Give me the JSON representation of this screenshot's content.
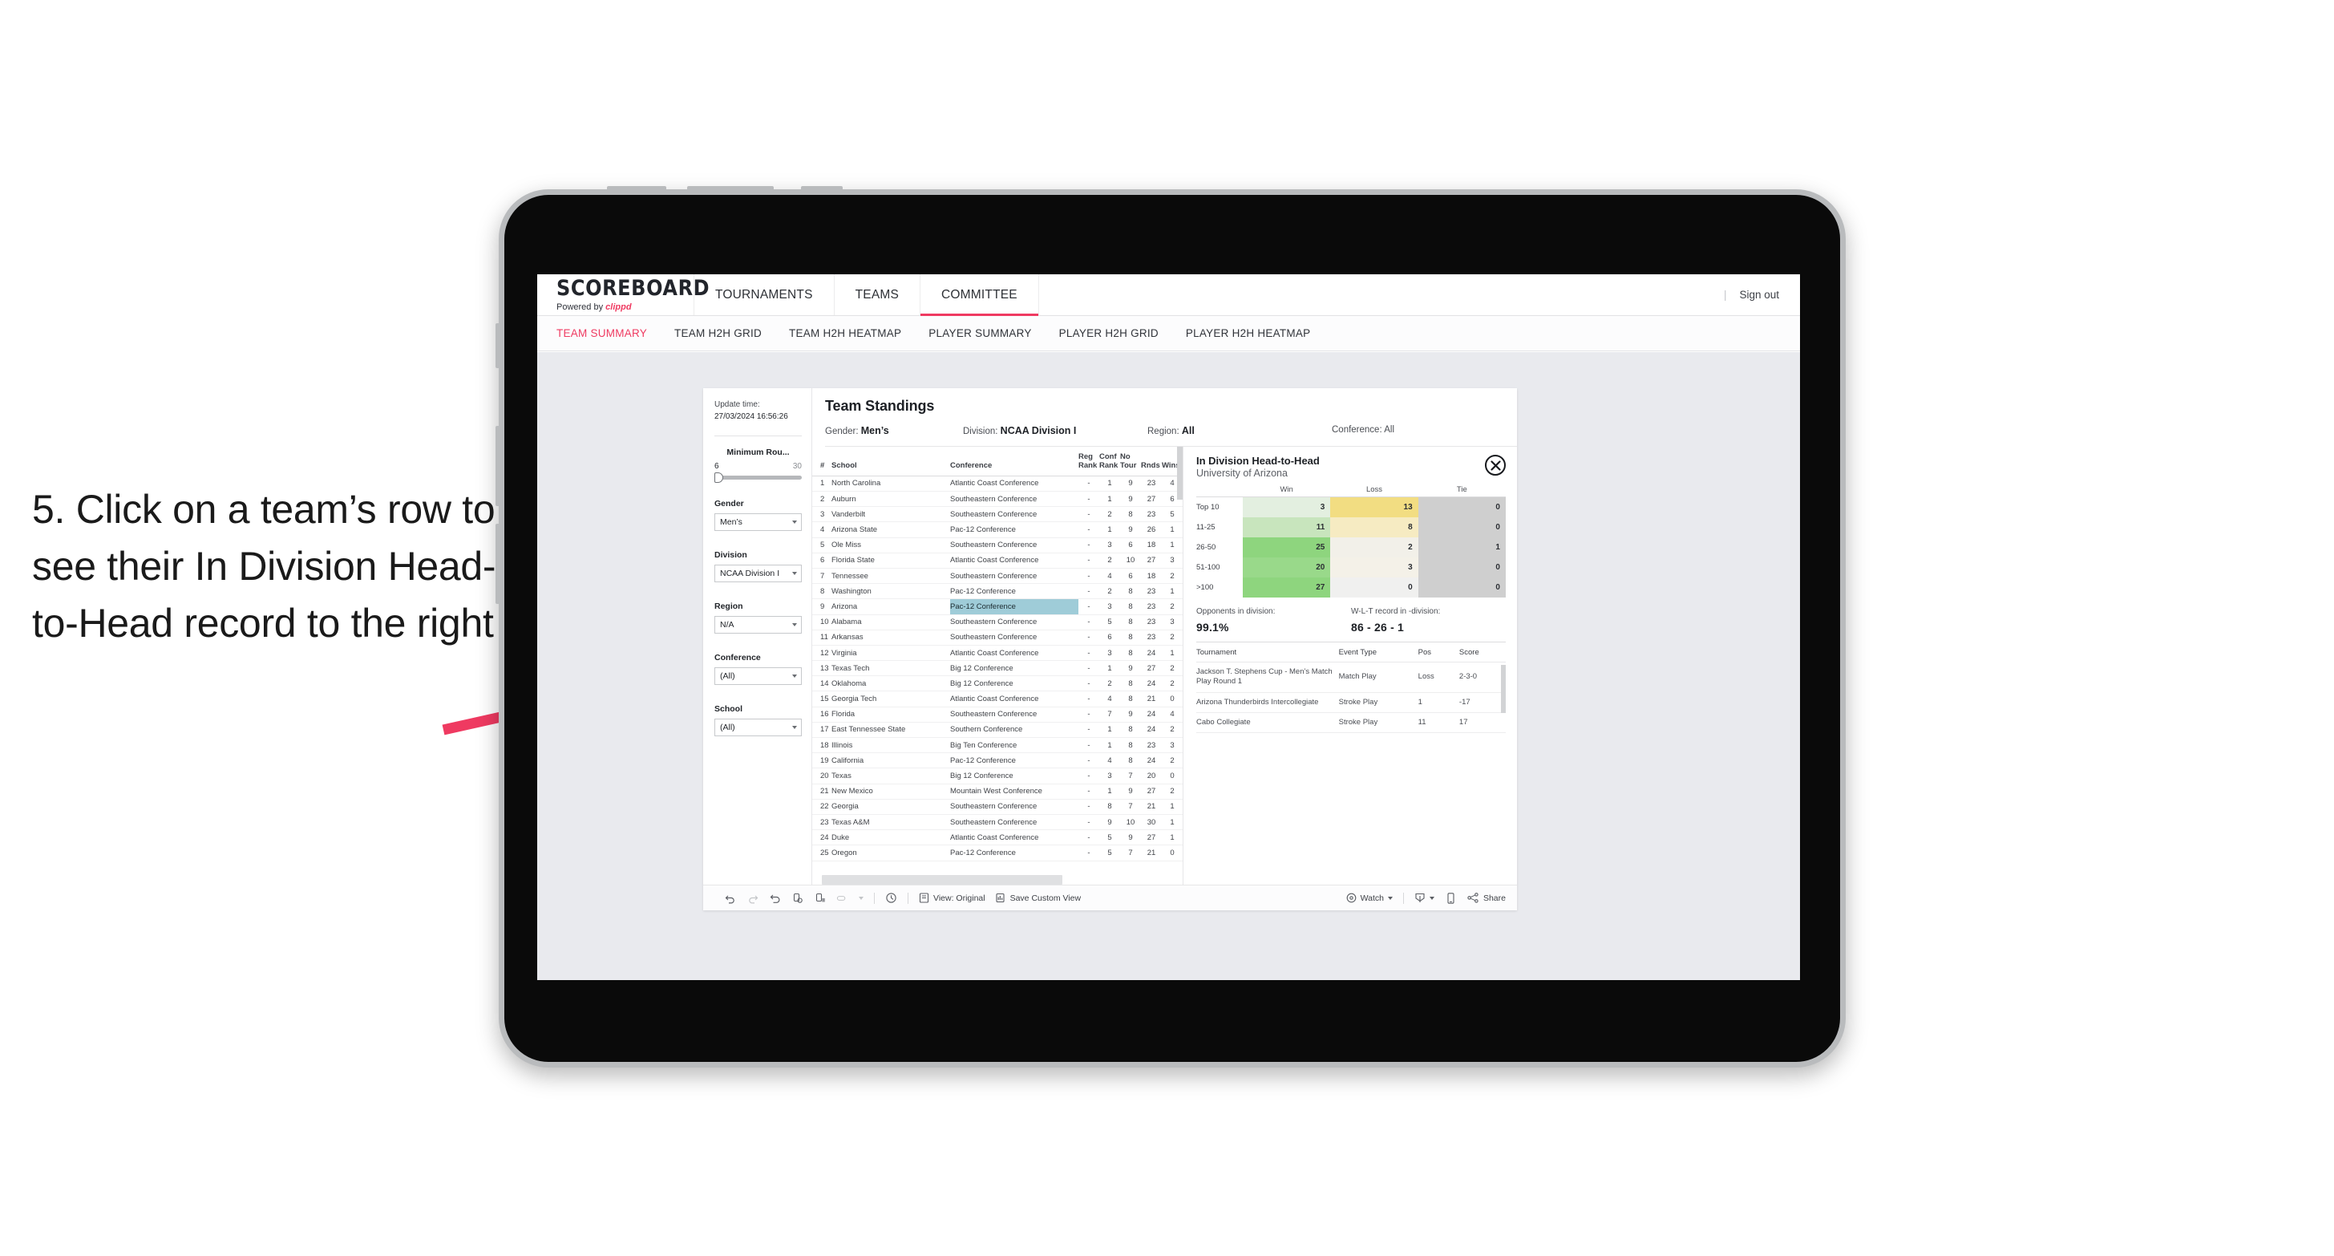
{
  "annotation": {
    "text": "5. Click on a team’s row to see their In Division Head-to-Head record to the right",
    "arrow_color": "#ef3a61"
  },
  "header": {
    "brand_title": "SCOREBOARD",
    "brand_sub_prefix": "Powered by ",
    "brand_sub_name": "clippd",
    "nav": [
      {
        "label": "TOURNAMENTS",
        "active": false
      },
      {
        "label": "TEAMS",
        "active": false
      },
      {
        "label": "COMMITTEE",
        "active": true
      }
    ],
    "divider": "|",
    "sign_out": "Sign out",
    "accent_color": "#ef3a61"
  },
  "subtabs": [
    {
      "label": "TEAM SUMMARY",
      "active": true
    },
    {
      "label": "TEAM H2H GRID",
      "active": false
    },
    {
      "label": "TEAM H2H HEATMAP",
      "active": false
    },
    {
      "label": "PLAYER SUMMARY",
      "active": false
    },
    {
      "label": "PLAYER H2H GRID",
      "active": false
    },
    {
      "label": "PLAYER H2H HEATMAP",
      "active": false
    }
  ],
  "filters": {
    "update_label": "Update time:",
    "update_value": "27/03/2024 16:56:26",
    "minimum_rounds": {
      "title": "Minimum Rou...",
      "min": "6",
      "max": "30"
    },
    "gender": {
      "title": "Gender",
      "value": "Men’s"
    },
    "division": {
      "title": "Division",
      "value": "NCAA Division I"
    },
    "region": {
      "title": "Region",
      "value": "N/A"
    },
    "conference": {
      "title": "Conference",
      "value": "(All)"
    },
    "school": {
      "title": "School",
      "value": "(All)"
    }
  },
  "standings": {
    "title": "Team Standings",
    "summary": [
      {
        "label": "Gender:",
        "value": "Men’s"
      },
      {
        "label": "Division:",
        "value": "NCAA Division I"
      },
      {
        "label": "Region:",
        "value": "All"
      },
      {
        "label": "Conference:",
        "value": "All"
      }
    ],
    "columns": {
      "rank": "#",
      "school": "School",
      "conference": "Conference",
      "reg_rank": "Reg Rank",
      "reg_rank_l1": "Reg",
      "reg_rank_l2": "Rank",
      "conf_rank_l1": "Conf",
      "conf_rank_l2": "Rank",
      "no_tour_l1": "No",
      "no_tour_l2": "Tour",
      "rnds": "Rnds",
      "wins": "Wins"
    },
    "selected_row_index": 8,
    "rows": [
      {
        "rank": "1",
        "school": "North Carolina",
        "conference": "Atlantic Coast Conference",
        "reg": "-",
        "conf": "1",
        "no_tour": "9",
        "rnds": "23",
        "wins": "4"
      },
      {
        "rank": "2",
        "school": "Auburn",
        "conference": "Southeastern Conference",
        "reg": "-",
        "conf": "1",
        "no_tour": "9",
        "rnds": "27",
        "wins": "6"
      },
      {
        "rank": "3",
        "school": "Vanderbilt",
        "conference": "Southeastern Conference",
        "reg": "-",
        "conf": "2",
        "no_tour": "8",
        "rnds": "23",
        "wins": "5"
      },
      {
        "rank": "4",
        "school": "Arizona State",
        "conference": "Pac-12 Conference",
        "reg": "-",
        "conf": "1",
        "no_tour": "9",
        "rnds": "26",
        "wins": "1"
      },
      {
        "rank": "5",
        "school": "Ole Miss",
        "conference": "Southeastern Conference",
        "reg": "-",
        "conf": "3",
        "no_tour": "6",
        "rnds": "18",
        "wins": "1"
      },
      {
        "rank": "6",
        "school": "Florida State",
        "conference": "Atlantic Coast Conference",
        "reg": "-",
        "conf": "2",
        "no_tour": "10",
        "rnds": "27",
        "wins": "3"
      },
      {
        "rank": "7",
        "school": "Tennessee",
        "conference": "Southeastern Conference",
        "reg": "-",
        "conf": "4",
        "no_tour": "6",
        "rnds": "18",
        "wins": "2"
      },
      {
        "rank": "8",
        "school": "Washington",
        "conference": "Pac-12 Conference",
        "reg": "-",
        "conf": "2",
        "no_tour": "8",
        "rnds": "23",
        "wins": "1"
      },
      {
        "rank": "9",
        "school": "Arizona",
        "conference": "Pac-12 Conference",
        "reg": "-",
        "conf": "3",
        "no_tour": "8",
        "rnds": "23",
        "wins": "2"
      },
      {
        "rank": "10",
        "school": "Alabama",
        "conference": "Southeastern Conference",
        "reg": "-",
        "conf": "5",
        "no_tour": "8",
        "rnds": "23",
        "wins": "3"
      },
      {
        "rank": "11",
        "school": "Arkansas",
        "conference": "Southeastern Conference",
        "reg": "-",
        "conf": "6",
        "no_tour": "8",
        "rnds": "23",
        "wins": "2"
      },
      {
        "rank": "12",
        "school": "Virginia",
        "conference": "Atlantic Coast Conference",
        "reg": "-",
        "conf": "3",
        "no_tour": "8",
        "rnds": "24",
        "wins": "1"
      },
      {
        "rank": "13",
        "school": "Texas Tech",
        "conference": "Big 12 Conference",
        "reg": "-",
        "conf": "1",
        "no_tour": "9",
        "rnds": "27",
        "wins": "2"
      },
      {
        "rank": "14",
        "school": "Oklahoma",
        "conference": "Big 12 Conference",
        "reg": "-",
        "conf": "2",
        "no_tour": "8",
        "rnds": "24",
        "wins": "2"
      },
      {
        "rank": "15",
        "school": "Georgia Tech",
        "conference": "Atlantic Coast Conference",
        "reg": "-",
        "conf": "4",
        "no_tour": "8",
        "rnds": "21",
        "wins": "0"
      },
      {
        "rank": "16",
        "school": "Florida",
        "conference": "Southeastern Conference",
        "reg": "-",
        "conf": "7",
        "no_tour": "9",
        "rnds": "24",
        "wins": "4"
      },
      {
        "rank": "17",
        "school": "East Tennessee State",
        "conference": "Southern Conference",
        "reg": "-",
        "conf": "1",
        "no_tour": "8",
        "rnds": "24",
        "wins": "2"
      },
      {
        "rank": "18",
        "school": "Illinois",
        "conference": "Big Ten Conference",
        "reg": "-",
        "conf": "1",
        "no_tour": "8",
        "rnds": "23",
        "wins": "3"
      },
      {
        "rank": "19",
        "school": "California",
        "conference": "Pac-12 Conference",
        "reg": "-",
        "conf": "4",
        "no_tour": "8",
        "rnds": "24",
        "wins": "2"
      },
      {
        "rank": "20",
        "school": "Texas",
        "conference": "Big 12 Conference",
        "reg": "-",
        "conf": "3",
        "no_tour": "7",
        "rnds": "20",
        "wins": "0"
      },
      {
        "rank": "21",
        "school": "New Mexico",
        "conference": "Mountain West Conference",
        "reg": "-",
        "conf": "1",
        "no_tour": "9",
        "rnds": "27",
        "wins": "2"
      },
      {
        "rank": "22",
        "school": "Georgia",
        "conference": "Southeastern Conference",
        "reg": "-",
        "conf": "8",
        "no_tour": "7",
        "rnds": "21",
        "wins": "1"
      },
      {
        "rank": "23",
        "school": "Texas A&M",
        "conference": "Southeastern Conference",
        "reg": "-",
        "conf": "9",
        "no_tour": "10",
        "rnds": "30",
        "wins": "1"
      },
      {
        "rank": "24",
        "school": "Duke",
        "conference": "Atlantic Coast Conference",
        "reg": "-",
        "conf": "5",
        "no_tour": "9",
        "rnds": "27",
        "wins": "1"
      },
      {
        "rank": "25",
        "school": "Oregon",
        "conference": "Pac-12 Conference",
        "reg": "-",
        "conf": "5",
        "no_tour": "7",
        "rnds": "21",
        "wins": "0"
      }
    ]
  },
  "h2h": {
    "title": "In Division Head-to-Head",
    "subtitle": "University of Arizona",
    "close_icon": "close-circle-icon",
    "chart_data": {
      "type": "heatmap",
      "title": "In Division Head-to-Head",
      "columns": [
        "Win",
        "Loss",
        "Tie"
      ],
      "rows": [
        "Top 10",
        "11-25",
        "26-50",
        "51-100",
        ">100"
      ],
      "values": [
        [
          3,
          13,
          0
        ],
        [
          11,
          8,
          0
        ],
        [
          25,
          2,
          1
        ],
        [
          20,
          3,
          0
        ],
        [
          27,
          0,
          0
        ]
      ],
      "cell_colors": [
        [
          "#e3efe0",
          "#f2dd82",
          "#cfcfcf"
        ],
        [
          "#c8e5bd",
          "#f6ebc2",
          "#cfcfcf"
        ],
        [
          "#8ed57e",
          "#f2f0e9",
          "#cfcfcf"
        ],
        [
          "#99d98a",
          "#f4f1e8",
          "#cfcfcf"
        ],
        [
          "#8ed57e",
          "#f0f0ef",
          "#cfcfcf"
        ]
      ]
    },
    "kpis": [
      {
        "label": "Opponents in division:",
        "value": "99.1%"
      },
      {
        "label": "W-L-T record in -division:",
        "value": "86 - 26 - 1"
      }
    ],
    "tournaments": {
      "columns": [
        "Tournament",
        "Event Type",
        "Pos",
        "Score"
      ],
      "rows": [
        {
          "name": "Jackson T. Stephens Cup - Men’s Match Play Round 1",
          "type": "Match Play",
          "pos": "Loss",
          "score": "2-3-0"
        },
        {
          "name": "Arizona Thunderbirds Intercollegiate",
          "type": "Stroke Play",
          "pos": "1",
          "score": "-17"
        },
        {
          "name": "Cabo Collegiate",
          "type": "Stroke Play",
          "pos": "11",
          "score": "17"
        }
      ]
    }
  },
  "toolbar": {
    "icons": [
      "undo-icon",
      "redo-icon",
      "revert-icon",
      "refresh-data-icon",
      "pause-updates-icon",
      "view-mode-icon"
    ],
    "clock_icon": "history-icon",
    "view_original": "View: Original",
    "save_custom_view": "Save Custom View",
    "watch": "Watch",
    "download_icon": "download-icon",
    "device_icon": "device-layout-icon",
    "share": "Share"
  }
}
